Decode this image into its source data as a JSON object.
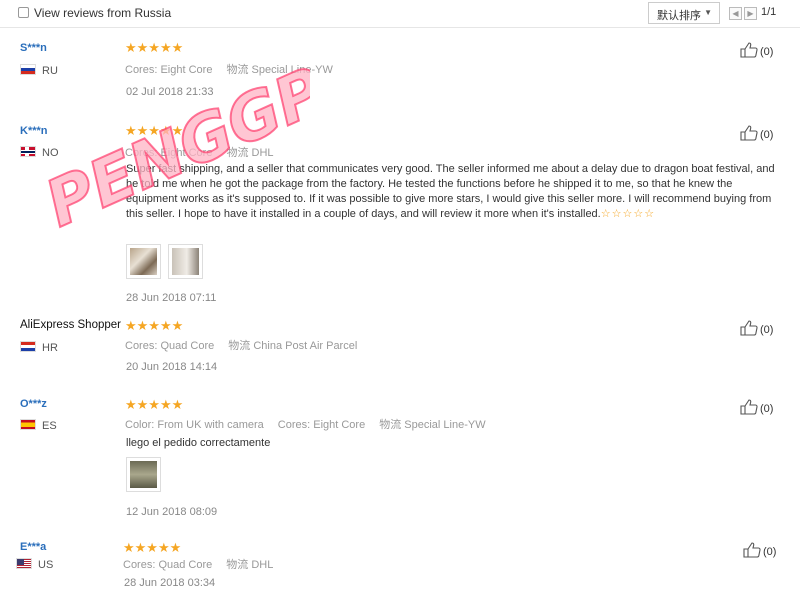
{
  "filter": {
    "label": "View reviews from Russia",
    "checked": false
  },
  "sort": {
    "label": "默认排序"
  },
  "pagination": {
    "prev_icon": "chevron-left-icon",
    "next_icon": "chevron-right-icon",
    "text": "1/1"
  },
  "watermark": {
    "text": "PENGGPS"
  },
  "colors": {
    "accent": "#2a6ebb",
    "star": "#f5a623",
    "watermark": "#ff3b6b"
  },
  "reviews": [
    {
      "user": "S***n",
      "country": "RU",
      "flag": "flag-ru",
      "rating": 5,
      "stars": "★★★★★",
      "cores_key": "Cores:",
      "cores_val": "Eight Core",
      "ship_key": "物流",
      "ship_val": "Special Line-YW",
      "date": "02 Jul 2018 21:33",
      "likes": "(0)"
    },
    {
      "user": "K***n",
      "country": "NO",
      "flag": "flag-no",
      "rating": 5,
      "stars": "★★★★★",
      "cores_key": "Cores:",
      "cores_val": "Eight Core",
      "ship_key": "物流",
      "ship_val": "DHL",
      "text": "Super fast shipping, and a seller that communicates very good. The seller informed me about a delay due to dragon boat festival, and he told me when he got the package from the factory. He tested the functions before he shipped it to me, so that he knew the equipment works as it's supposed to. If it was possible to give more stars, I would give this seller more. I will recommend buying from this seller. I hope to have it installed in a couple of days, and will review it more when it's installed.",
      "text_stars": "☆☆☆☆☆",
      "date": "28 Jun 2018 07:11",
      "likes": "(0)"
    },
    {
      "user": "AliExpress Shopper",
      "country": "HR",
      "flag": "flag-hr",
      "rating": 5,
      "stars": "★★★★★",
      "cores_key": "Cores:",
      "cores_val": "Quad Core",
      "ship_key": "物流",
      "ship_val": "China Post Air Parcel",
      "date": "20 Jun 2018 14:14",
      "likes": "(0)"
    },
    {
      "user": "O***z",
      "country": "ES",
      "flag": "flag-es",
      "rating": 5,
      "stars": "★★★★★",
      "color_key": "Color:",
      "color_val": "From UK with camera",
      "cores_key": "Cores:",
      "cores_val": "Eight Core",
      "ship_key": "物流",
      "ship_val": "Special Line-YW",
      "text": "llego el pedido correctamente",
      "date": "12 Jun 2018 08:09",
      "likes": "(0)"
    },
    {
      "user": "E***a",
      "country": "US",
      "flag": "flag-us",
      "rating": 5,
      "stars": "★★★★★",
      "cores_key": "Cores:",
      "cores_val": "Quad Core",
      "ship_key": "物流",
      "ship_val": "DHL",
      "date": "28 Jun 2018 03:34",
      "likes": "(0)"
    }
  ]
}
